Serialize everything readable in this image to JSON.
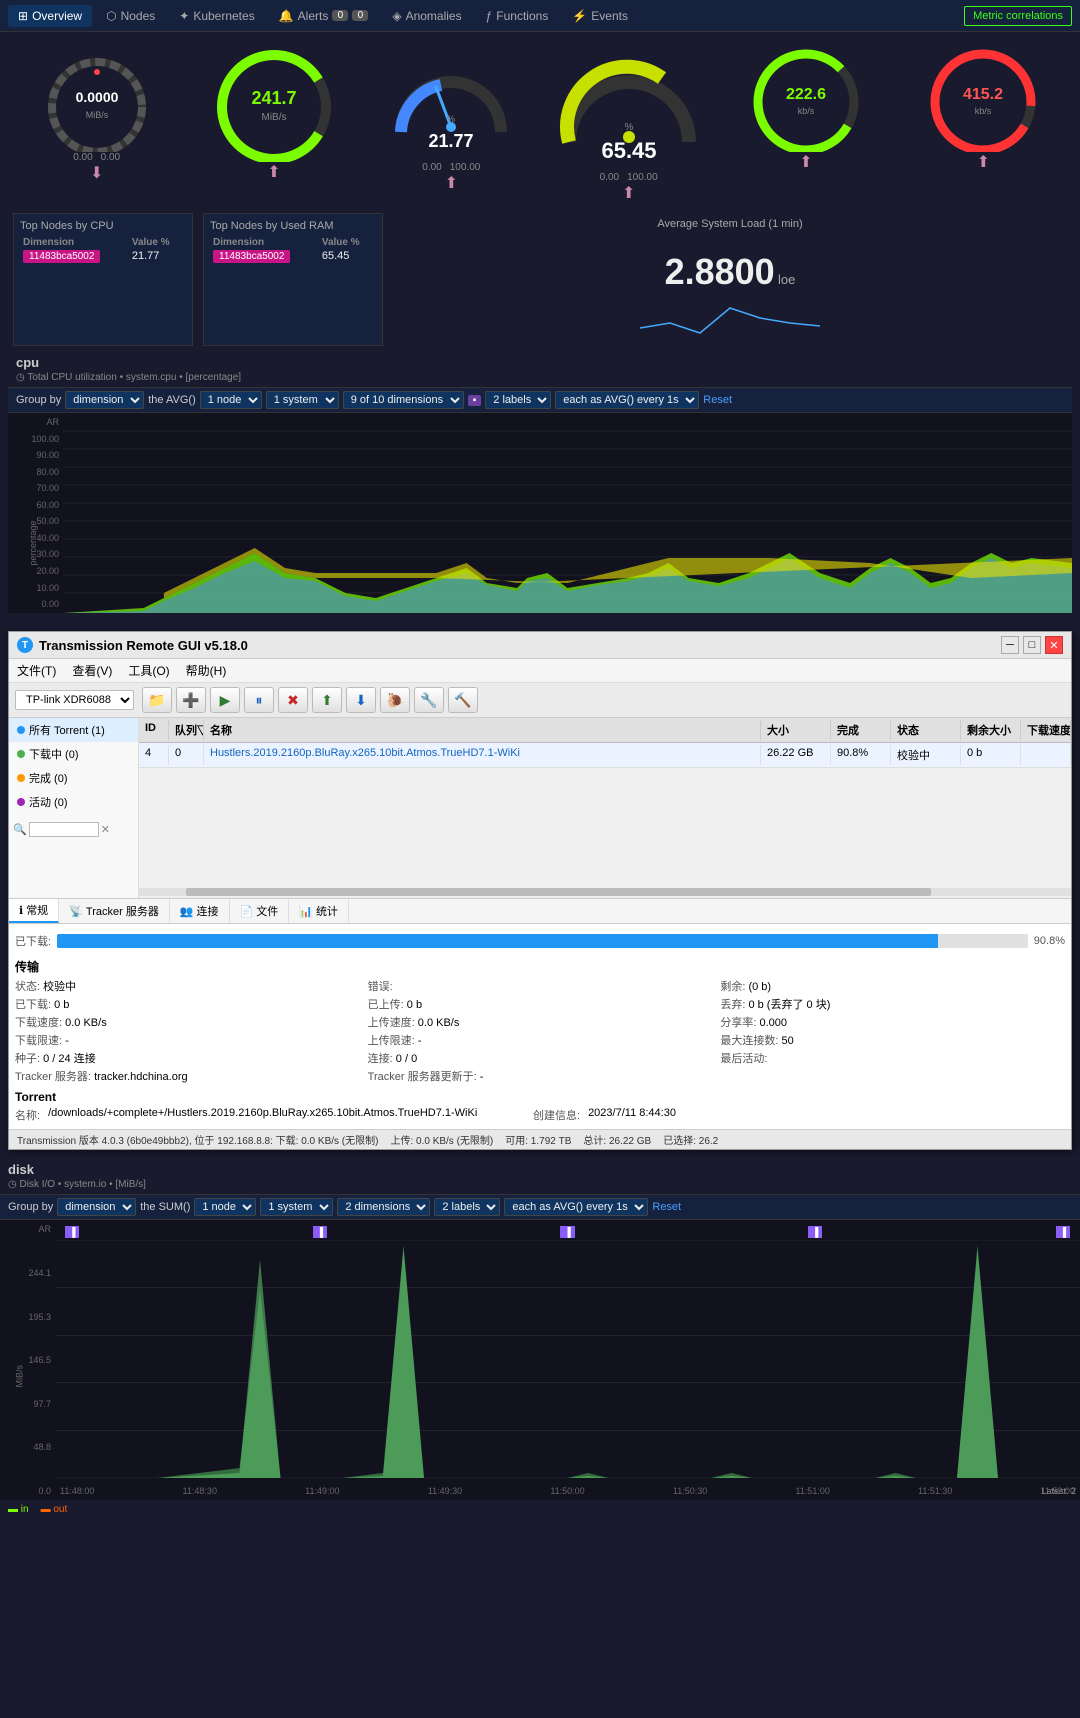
{
  "nav": {
    "items": [
      {
        "label": "Overview",
        "icon": "grid-icon",
        "active": true
      },
      {
        "label": "Nodes",
        "icon": "nodes-icon",
        "active": false
      },
      {
        "label": "Kubernetes",
        "icon": "k8s-icon",
        "active": false
      },
      {
        "label": "Alerts",
        "icon": "bell-icon",
        "active": false
      },
      {
        "label": "Anomalies",
        "icon": "anomalies-icon",
        "active": false
      },
      {
        "label": "Functions",
        "icon": "functions-icon",
        "active": false
      },
      {
        "label": "Events",
        "icon": "events-icon",
        "active": false
      }
    ],
    "alert_count_red": "0",
    "alert_count_blue": "0",
    "metric_correlations": "Metric correlations"
  },
  "gauges": [
    {
      "label": "MiB/s",
      "value": "0.0000",
      "color": "#888",
      "type": "circle",
      "min": "0.00",
      "max": "0.00"
    },
    {
      "label": "MiB/s",
      "value": "241.7",
      "color": "#7cfc00",
      "type": "circle",
      "min": "",
      "max": ""
    },
    {
      "label": "%",
      "value": "21.77",
      "color": "#4488ff",
      "type": "gauge",
      "min": "0.00",
      "max": "100.00"
    },
    {
      "label": "%",
      "value": "65.45",
      "color": "#c8e000",
      "type": "gauge",
      "min": "0.00",
      "max": "100.00"
    },
    {
      "label": "kb/s",
      "value": "222.6",
      "color": "#7cfc00",
      "type": "circle",
      "min": "",
      "max": ""
    },
    {
      "label": "kb/s",
      "value": "415.2",
      "color": "#ff4444",
      "type": "circle",
      "min": "",
      "max": ""
    }
  ],
  "top_nodes_cpu": {
    "title": "Top Nodes by CPU",
    "col1": "Dimension",
    "col2": "Value %",
    "rows": [
      {
        "dim": "11483bca5002",
        "val": "21.77"
      }
    ]
  },
  "top_nodes_ram": {
    "title": "Top Nodes by Used RAM",
    "col1": "Dimension",
    "col2": "Value %",
    "rows": [
      {
        "dim": "11483bca5002",
        "val": "65.45"
      }
    ]
  },
  "avg_load": {
    "title": "Average System Load (1 min)",
    "value": "2.8800",
    "unit": "loe"
  },
  "cpu_section": {
    "label": "cpu",
    "subtitle": "◷ Total CPU utilization • system.cpu • [percentage]",
    "filter": {
      "group_by": "dimension",
      "avg_func": "the AVG()",
      "node_count": "1 node",
      "system_count": "1 system",
      "dimensions": "9 of 10 dimensions",
      "labels": "2 labels",
      "each_as": "each as AVG() every 1s",
      "reset": "Reset"
    },
    "yaxis": [
      "AR",
      "100.00",
      "90.00",
      "80.00",
      "70.00",
      "60.00",
      "50.00",
      "40.00",
      "30.00",
      "20.00",
      "10.00",
      "0.00"
    ],
    "yaxis_label": "percentage"
  },
  "transmission": {
    "title": "Transmission Remote GUI v5.18.0",
    "menus": [
      "文件(T)",
      "查看(V)",
      "工具(O)",
      "帮助(H)"
    ],
    "server": "TP-link XDR6088",
    "toolbar_btns": [
      "📁",
      "➕",
      "▶",
      "⏸",
      "✖",
      "⬆",
      "⬇",
      "🐌",
      "🔧",
      "🔨"
    ],
    "sidebar_items": [
      {
        "label": "所有 Torrent (1)",
        "dot": "all",
        "active": true
      },
      {
        "label": "下载中 (0)",
        "dot": "downloading"
      },
      {
        "label": "完成 (0)",
        "dot": "complete"
      },
      {
        "label": "活动 (0)",
        "dot": "active2"
      }
    ],
    "table_headers": [
      "ID",
      "队列▽",
      "名称",
      "大小",
      "完成",
      "状态",
      "剩余大小",
      "下载速度"
    ],
    "table_rows": [
      {
        "id": "4",
        "queue": "0",
        "name": "Hustlers.2019.2160p.BluRay.x265.10bit.Atmos.TrueHD7.1-WiKi",
        "size": "26.22 GB",
        "done": "90.8%",
        "status": "校验中",
        "remain": "0 b",
        "speed": ""
      }
    ],
    "tabs": [
      "常规",
      "Tracker 服务器",
      "连接",
      "文件",
      "统计"
    ],
    "active_tab": "常规",
    "progress_percent": 90.8,
    "progress_label": "90.8%",
    "section_transfer": "传输",
    "transfer_details": {
      "status_key": "状态:",
      "status_val": "校验中",
      "error_key": "错误:",
      "error_val": "",
      "remain_key": "剩余:",
      "remain_val": "(0 b)",
      "downloaded_key": "已下载:",
      "downloaded_val": "0 b",
      "uploaded_key": "已上传:",
      "uploaded_val": "0 b",
      "discard_key": "丢弃:",
      "discard_val": "0 b (丢弃了 0 块)",
      "dl_speed_key": "下载速度:",
      "dl_speed_val": "0.0 KB/s",
      "ul_speed_key": "上传速度:",
      "ul_speed_val": "0.0 KB/s",
      "share_key": "分享率:",
      "share_val": "0.000",
      "dl_limit_key": "下载限速:",
      "dl_limit_val": "-",
      "ul_limit_key": "上传限速:",
      "ul_limit_val": "-",
      "max_conn_key": "最大连接数:",
      "max_conn_val": "50",
      "seeds_key": "种子:",
      "seeds_val": "0 / 24 连接",
      "peers_key": "连接:",
      "peers_val": "0 / 0",
      "last_active_key": "最后活动:",
      "last_active_val": "",
      "tracker_key": "Tracker 服务器:",
      "tracker_val": "tracker.hdchina.org",
      "tracker_update_key": "Tracker 服务器更新于:",
      "tracker_update_val": "-"
    },
    "section_torrent": "Torrent",
    "torrent_details": {
      "name_key": "名称:",
      "name_val": "/downloads/+complete+/Hustlers.2019.2160p.BluRay.x265.10bit.Atmos.TrueHD7.1-WiKi",
      "created_key": "创建信息:",
      "created_val": "2023/7/11 8:44:30"
    },
    "statusbar": {
      "version": "Transmission 版本 4.0.3 (6b0e49bbb2), 位于 192.168.8.8: 下载: 0.0 KB/s (无限制)",
      "upload": "上传: 0.0 KB/s (无限制)",
      "available": "可用: 1.792 TB",
      "total": "总计: 26.22 GB",
      "selected": "已选择: 26.2"
    }
  },
  "disk_section": {
    "label": "disk",
    "subtitle": "◷ Disk I/O • system.io • [MiB/s]",
    "filter": {
      "group_by": "dimension",
      "sum_func": "the SUM()",
      "node_count": "1 node",
      "system_count": "1 system",
      "dimensions": "2 dimensions",
      "labels": "2 labels",
      "each_as": "each as AVG() every 1s",
      "reset": "Reset"
    },
    "yaxis": [
      "AR",
      "244.1",
      "195.3",
      "146.5",
      "97.7",
      "48.8",
      "0.0"
    ],
    "yaxis_label": "MiB/s",
    "xaxis": [
      "11:48:00",
      "11:48:30",
      "11:49:00",
      "11:49:30",
      "11:50:00",
      "11:50:30",
      "11:51:00",
      "11:51:30",
      "11:52:00"
    ],
    "latest_label": "Latest: 2",
    "legend": [
      {
        "label": "in",
        "color": "#7cfc00"
      },
      {
        "label": "out",
        "color": "#ff6600"
      }
    ]
  }
}
